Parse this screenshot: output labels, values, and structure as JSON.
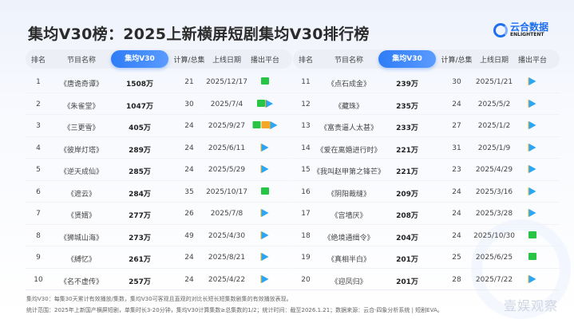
{
  "title": "集均V30榜：2025上新横屏短剧集均V30排行榜",
  "logo": {
    "cn": "云合数据",
    "en": "ENLIGHTENT"
  },
  "headers": {
    "rank": "排名",
    "name": "节目名称",
    "v30": "集均V30",
    "episodes": "计算/总集",
    "date": "上线日期",
    "platform": "播出平台"
  },
  "colors": {
    "accent": "#2e7cf6",
    "iqiyi": "#28c445",
    "mango": "#f5a623",
    "tencent": "#2aa6f5"
  },
  "left": [
    {
      "rank": "1",
      "name": "《唐诡奇谭》",
      "v30": "1508万",
      "episodes": "21",
      "date": "2025/12/17",
      "platforms": [
        "iqiyi"
      ]
    },
    {
      "rank": "2",
      "name": "《朱雀堂》",
      "v30": "1047万",
      "episodes": "30",
      "date": "2025/7/4",
      "platforms": [
        "iqiyi",
        "tencent"
      ]
    },
    {
      "rank": "3",
      "name": "《三更雪》",
      "v30": "405万",
      "episodes": "24",
      "date": "2025/9/27",
      "platforms": [
        "iqiyi",
        "mango",
        "tencent"
      ]
    },
    {
      "rank": "4",
      "name": "《彼岸灯塔》",
      "v30": "289万",
      "episodes": "24",
      "date": "2025/6/11",
      "platforms": [
        "tencent"
      ]
    },
    {
      "rank": "5",
      "name": "《逆天成仙》",
      "v30": "285万",
      "episodes": "24",
      "date": "2025/5/29",
      "platforms": [
        "tencent"
      ]
    },
    {
      "rank": "6",
      "name": "《遮云》",
      "v30": "284万",
      "episodes": "35",
      "date": "2025/10/17",
      "platforms": [
        "iqiyi"
      ]
    },
    {
      "rank": "7",
      "name": "《贤婿》",
      "v30": "277万",
      "episodes": "26",
      "date": "2025/7/8",
      "platforms": [
        "tencent"
      ]
    },
    {
      "rank": "8",
      "name": "《狮城山海》",
      "v30": "273万",
      "episodes": "49",
      "date": "2025/4/30",
      "platforms": [
        "tencent"
      ]
    },
    {
      "rank": "9",
      "name": "《縛忆》",
      "v30": "261万",
      "episodes": "24",
      "date": "2025/8/21",
      "platforms": [
        "tencent"
      ]
    },
    {
      "rank": "10",
      "name": "《名不虚传》",
      "v30": "257万",
      "episodes": "24",
      "date": "2025/4/22",
      "platforms": [
        "tencent"
      ]
    }
  ],
  "right": [
    {
      "rank": "11",
      "name": "《点石成金》",
      "v30": "239万",
      "episodes": "30",
      "date": "2025/1/21",
      "platforms": [
        "tencent"
      ]
    },
    {
      "rank": "12",
      "name": "《藏珠》",
      "v30": "235万",
      "episodes": "24",
      "date": "2025/5/2",
      "platforms": [
        "tencent"
      ]
    },
    {
      "rank": "13",
      "name": "《富贵逼人太甚》",
      "v30": "233万",
      "episodes": "27",
      "date": "2025/1/2",
      "platforms": [
        "tencent"
      ]
    },
    {
      "rank": "14",
      "name": "《爱在离婚进行时》",
      "v30": "221万",
      "episodes": "31",
      "date": "2025/1/9",
      "platforms": [
        "tencent"
      ]
    },
    {
      "rank": "15",
      "name": "《我叫赵甲第之锋芒》",
      "v30": "221万",
      "episodes": "23",
      "date": "2025/4/29",
      "platforms": [
        "tencent"
      ]
    },
    {
      "rank": "16",
      "name": "《阴阳裁缝》",
      "v30": "209万",
      "episodes": "24",
      "date": "2025/3/16",
      "platforms": [
        "tencent"
      ]
    },
    {
      "rank": "17",
      "name": "《宫墙厌》",
      "v30": "208万",
      "episodes": "24",
      "date": "2025/3/28",
      "platforms": [
        "tencent"
      ]
    },
    {
      "rank": "18",
      "name": "《绝境通缉令》",
      "v30": "204万",
      "episodes": "24",
      "date": "2025/10/30",
      "platforms": [
        "iqiyi"
      ]
    },
    {
      "rank": "19",
      "name": "《真相半白》",
      "v30": "201万",
      "episodes": "25",
      "date": "2025/6/25",
      "platforms": [
        "iqiyi"
      ]
    },
    {
      "rank": "20",
      "name": "《迎凤归》",
      "v30": "201万",
      "episodes": "28",
      "date": "2025/7/22",
      "platforms": [
        "tencent"
      ]
    }
  ],
  "footer": {
    "line1": "集均V30：每集30天累计有效播放/集数，集均V30可客观且直观的对比长短长短集数剧集的有效播放表现。",
    "line2": "统计范围：2025年上新国产横屏短剧，单集时长3-20分钟，集均V30计算集数≥总集数的1/2；统计时间：截至2026.1.21；数据来源：云合·四象分析系统 | 短剧EVA。"
  },
  "watermark": "壹娱观察"
}
